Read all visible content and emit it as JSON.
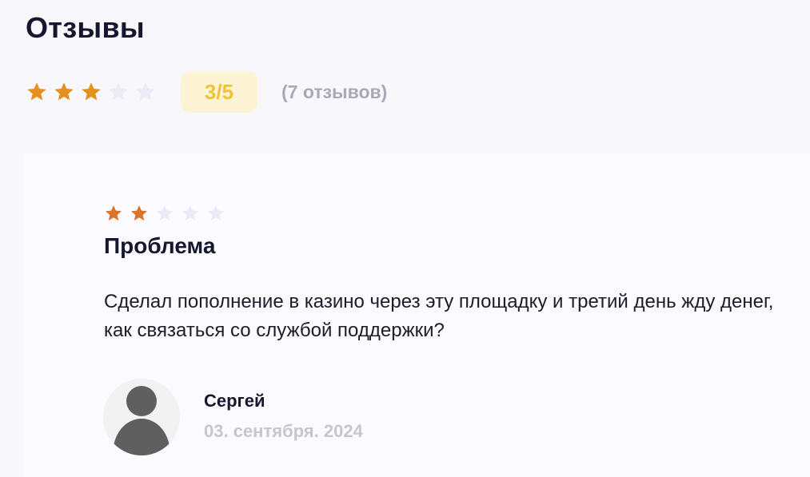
{
  "section": {
    "title": "Отзывы"
  },
  "summary": {
    "rating_value": 3,
    "rating_max": 5,
    "rating_label": "3/5",
    "review_count_label": "(7 отзывов)"
  },
  "review": {
    "rating_value": 2,
    "rating_max": 5,
    "title": "Проблема",
    "text": "Сделал пополнение в казино через эту площадку и третий день жду денег, как связаться со службой поддержки?",
    "author": "Сергей",
    "date": "03. сентября. 2024"
  },
  "icons": {
    "star": "star-icon",
    "avatar": "user-avatar-icon"
  },
  "colors": {
    "star_filled_summary": "#e3901e",
    "star_filled_review": "#d9742a",
    "star_empty": "#ebebf7",
    "badge_bg": "#fdf4d6",
    "badge_text": "#f0c23c",
    "muted_text": "#a8a8b6",
    "date_text": "#c6c6cf",
    "heading": "#16162e"
  }
}
